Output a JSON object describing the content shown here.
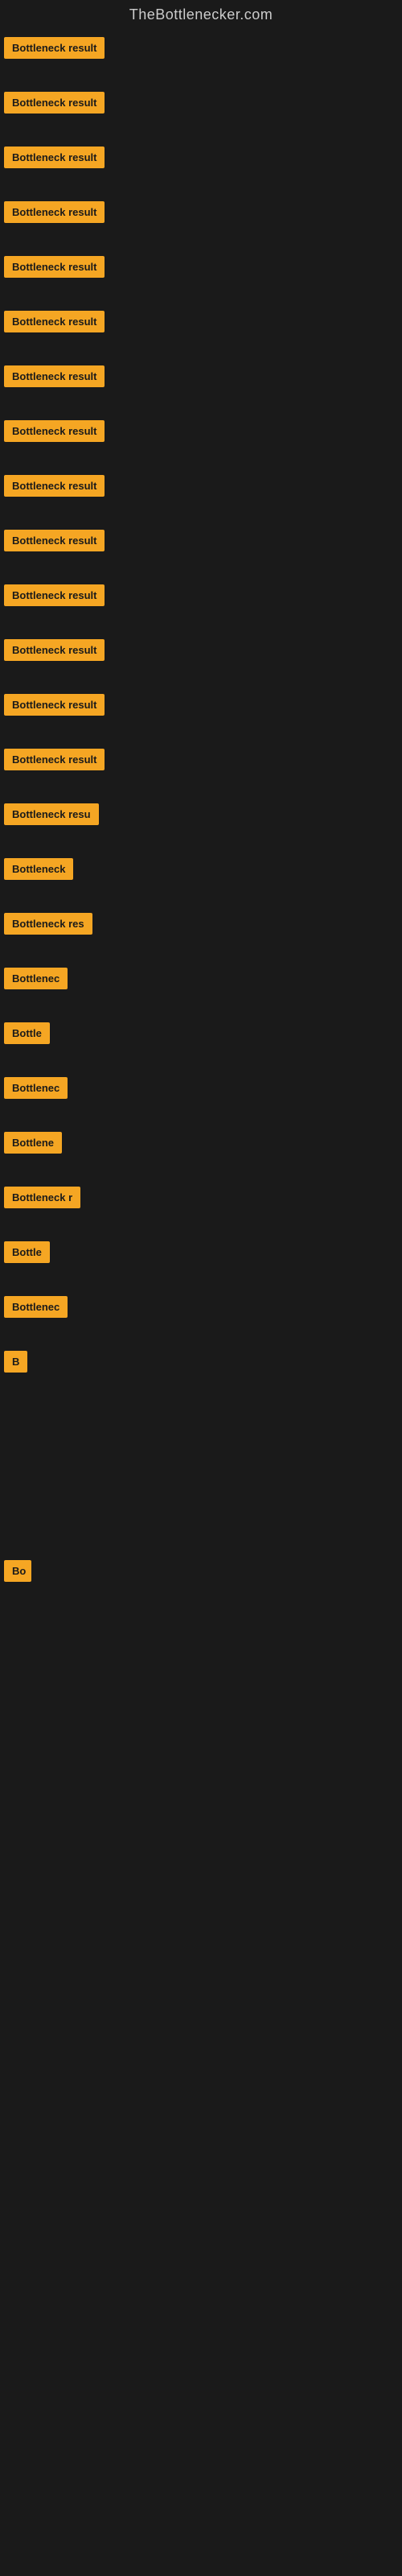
{
  "site": {
    "title": "TheBottlenecker.com"
  },
  "items": [
    {
      "id": 1,
      "label": "Bottleneck result",
      "width": 145
    },
    {
      "id": 2,
      "label": "Bottleneck result",
      "width": 145
    },
    {
      "id": 3,
      "label": "Bottleneck result",
      "width": 145
    },
    {
      "id": 4,
      "label": "Bottleneck result",
      "width": 145
    },
    {
      "id": 5,
      "label": "Bottleneck result",
      "width": 145
    },
    {
      "id": 6,
      "label": "Bottleneck result",
      "width": 145
    },
    {
      "id": 7,
      "label": "Bottleneck result",
      "width": 145
    },
    {
      "id": 8,
      "label": "Bottleneck result",
      "width": 145
    },
    {
      "id": 9,
      "label": "Bottleneck result",
      "width": 145
    },
    {
      "id": 10,
      "label": "Bottleneck result",
      "width": 145
    },
    {
      "id": 11,
      "label": "Bottleneck result",
      "width": 145
    },
    {
      "id": 12,
      "label": "Bottleneck result",
      "width": 140
    },
    {
      "id": 13,
      "label": "Bottleneck result",
      "width": 138
    },
    {
      "id": 14,
      "label": "Bottleneck result",
      "width": 135
    },
    {
      "id": 15,
      "label": "Bottleneck resu",
      "width": 122
    },
    {
      "id": 16,
      "label": "Bottleneck",
      "width": 88
    },
    {
      "id": 17,
      "label": "Bottleneck res",
      "width": 112
    },
    {
      "id": 18,
      "label": "Bottlenec",
      "width": 80
    },
    {
      "id": 19,
      "label": "Bottle",
      "width": 60
    },
    {
      "id": 20,
      "label": "Bottlenec",
      "width": 80
    },
    {
      "id": 21,
      "label": "Bottlene",
      "width": 72
    },
    {
      "id": 22,
      "label": "Bottleneck r",
      "width": 96
    },
    {
      "id": 23,
      "label": "Bottle",
      "width": 58
    },
    {
      "id": 24,
      "label": "Bottlenec",
      "width": 80
    },
    {
      "id": 25,
      "label": "B",
      "width": 20
    },
    {
      "id": 26,
      "label": "",
      "width": 0
    },
    {
      "id": 27,
      "label": "",
      "width": 0
    },
    {
      "id": 28,
      "label": "",
      "width": 0
    },
    {
      "id": 29,
      "label": "",
      "width": 0
    },
    {
      "id": 30,
      "label": "Bo",
      "width": 24
    },
    {
      "id": 31,
      "label": "",
      "width": 0
    },
    {
      "id": 32,
      "label": "",
      "width": 0
    },
    {
      "id": 33,
      "label": "",
      "width": 0
    },
    {
      "id": 34,
      "label": "",
      "width": 0
    },
    {
      "id": 35,
      "label": "",
      "width": 0
    }
  ]
}
